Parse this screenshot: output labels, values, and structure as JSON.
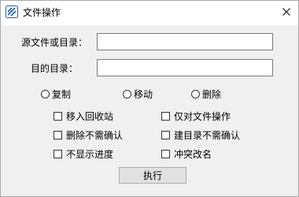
{
  "window": {
    "title": "文件操作",
    "icon": "app-document-icon",
    "close_icon": "close-icon"
  },
  "form": {
    "source_label": "源文件或目录：",
    "source_value": "",
    "target_label": "目的目录：",
    "target_value": ""
  },
  "operation": {
    "options": [
      {
        "label": "复制",
        "selected": false
      },
      {
        "label": "移动",
        "selected": false
      },
      {
        "label": "删除",
        "selected": false
      }
    ]
  },
  "options": {
    "recycle": {
      "label": "移入回收站",
      "checked": false
    },
    "files_only": {
      "label": "仅对文件操作",
      "checked": false
    },
    "delete_no_confirm": {
      "label": "删除不需确认",
      "checked": false
    },
    "mkdir_no_confirm": {
      "label": "建目录不需确认",
      "checked": false
    },
    "hide_progress": {
      "label": "不显示进度",
      "checked": false
    },
    "rename_on_conflict": {
      "label": "冲突改名",
      "checked": false
    }
  },
  "actions": {
    "execute_label": "执行"
  },
  "colors": {
    "dialog_bg": "#f0f0f0",
    "titlebar_bg": "#ffffff",
    "icon_blue": "#1e5fa8",
    "button_bg": "#e1e1e1"
  }
}
